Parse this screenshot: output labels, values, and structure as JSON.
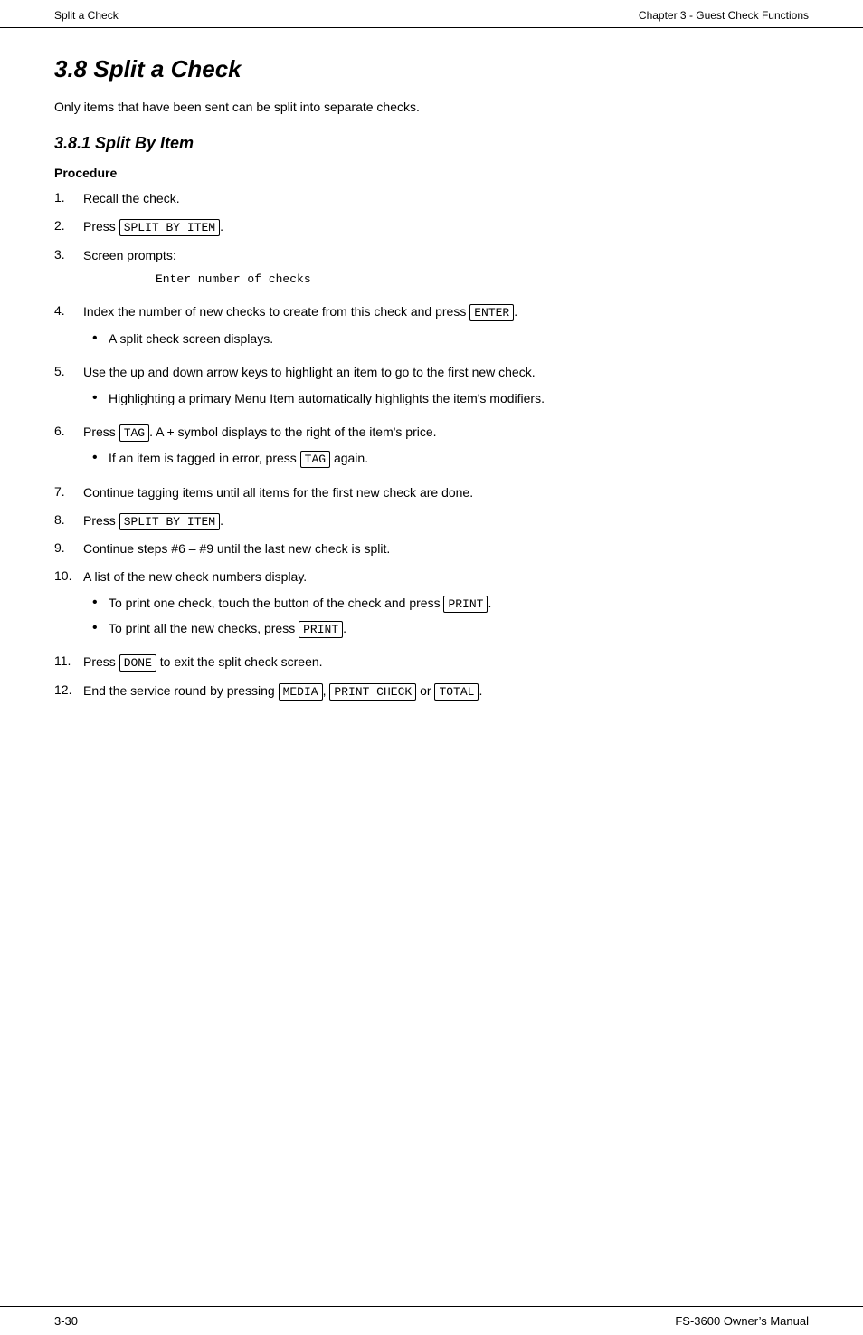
{
  "header": {
    "left": "Split a Check",
    "right": "Chapter 3 - Guest Check Functions"
  },
  "chapter": {
    "title": "3.8    Split a Check",
    "intro": "Only items that have been sent can be split into separate checks."
  },
  "section381": {
    "title": "3.8.1    Split By Item",
    "procedure_heading": "Procedure"
  },
  "steps": [
    {
      "num": "1.",
      "text": "Recall the check.",
      "has_key": false,
      "key": "",
      "sub_bullets": []
    },
    {
      "num": "2.",
      "text_before": "Press ",
      "key": "SPLIT BY ITEM",
      "text_after": ".",
      "has_key": true,
      "sub_bullets": []
    },
    {
      "num": "3.",
      "text_before": "Screen prompts:",
      "has_key": false,
      "monospace": "Enter number of checks",
      "sub_bullets": []
    },
    {
      "num": "4.",
      "text_before": "Index the number of new checks to create from this check and press ",
      "key": "ENTER",
      "text_after": ".",
      "has_key": true,
      "sub_bullets": [
        "A split check screen displays."
      ]
    },
    {
      "num": "5.",
      "text_before": "Use the up and down arrow keys to highlight an item to go to the first new check.",
      "has_key": false,
      "sub_bullets": [
        "Highlighting a primary Menu Item automatically highlights the item’s modifiers."
      ]
    },
    {
      "num": "6.",
      "text_before": "Press ",
      "key": "TAG",
      "text_after": ".  A + symbol displays to the right of the item’s price.",
      "has_key": true,
      "sub_bullets_keyed": [
        {
          "before": "If an item is tagged in error, press ",
          "key": "TAG",
          "after": " again."
        }
      ]
    },
    {
      "num": "7.",
      "text_before": "Continue tagging items until all items for the first new check are done.",
      "has_key": false,
      "sub_bullets": []
    },
    {
      "num": "8.",
      "text_before": "Press ",
      "key": "SPLIT BY ITEM",
      "text_after": ".",
      "has_key": true,
      "sub_bullets": []
    },
    {
      "num": "9.",
      "text_before": "Continue steps #6 – #9 until the last new check is split.",
      "has_key": false,
      "sub_bullets": []
    },
    {
      "num": "10.",
      "text_before": "A list of the new check numbers display.",
      "has_key": false,
      "sub_bullets_mixed": [
        {
          "before": "To print one check, touch the button of the check and press ",
          "key": "PRINT",
          "after": "."
        },
        {
          "before": "To print all the new checks, press ",
          "key": "PRINT",
          "after": "."
        }
      ]
    },
    {
      "num": "11.",
      "text_before": "Press ",
      "key": "DONE",
      "text_after": " to exit the split check screen.",
      "has_key": true,
      "sub_bullets": []
    },
    {
      "num": "12.",
      "text_before": "End the service round by pressing ",
      "key1": "MEDIA",
      "text_mid": ", ",
      "key2": "PRINT CHECK",
      "text_after": " or ",
      "key3": "TOTAL",
      "text_end": ".",
      "has_multi_key": true,
      "sub_bullets": []
    }
  ],
  "footer": {
    "left": "3-30",
    "right": "FS-3600 Owner’s Manual"
  }
}
